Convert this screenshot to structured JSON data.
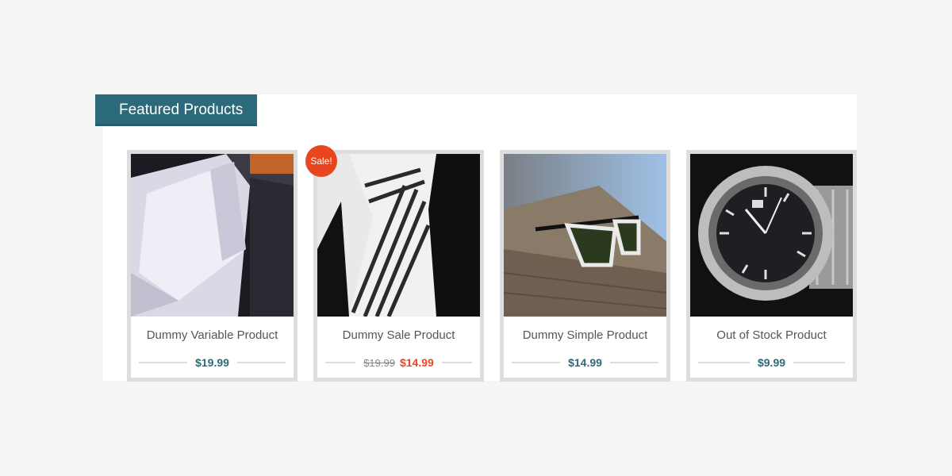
{
  "section": {
    "title": "Featured Products"
  },
  "badge": {
    "sale": "Sale!"
  },
  "products": [
    {
      "name": "Dummy Variable Product",
      "price": "$19.99",
      "image": "shirt-collar-photo"
    },
    {
      "name": "Dummy Sale Product",
      "old_price": "$19.99",
      "sale_price": "$14.99",
      "image": "striped-tie-photo"
    },
    {
      "name": "Dummy Simple Product",
      "price": "$14.99",
      "image": "sunglasses-photo"
    },
    {
      "name": "Out of Stock Product",
      "price": "$9.99",
      "image": "wristwatch-photo"
    }
  ],
  "colors": {
    "accent": "#2b6a7b",
    "sale": "#e8461e",
    "border": "#dddddd"
  }
}
